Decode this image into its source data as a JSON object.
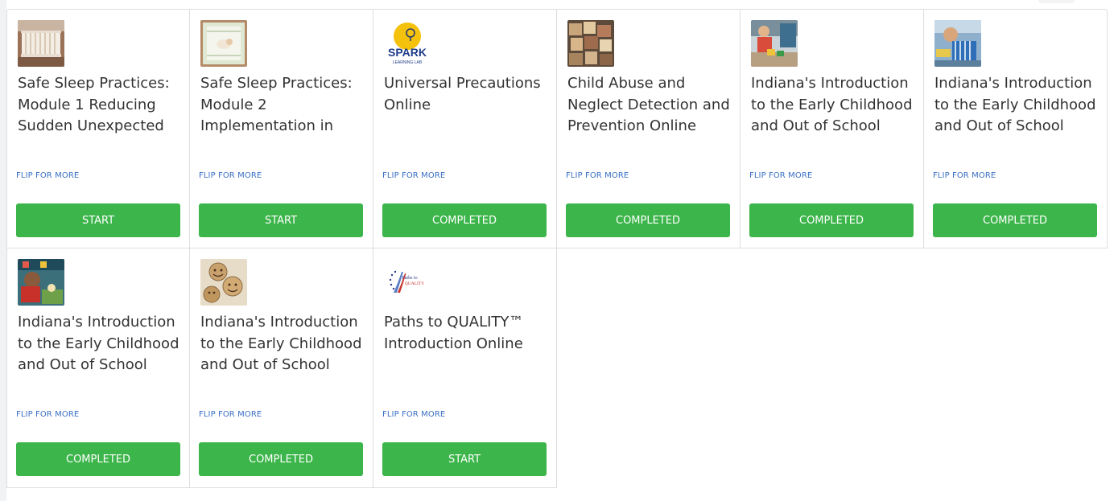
{
  "courses": [
    {
      "title": "Safe Sleep Practices: Module 1 Reducing Sudden Unexpected",
      "flip_label": "FLIP FOR MORE",
      "action_label": "START",
      "thumbnail": "crib-photo"
    },
    {
      "title": "Safe Sleep Practices: Module 2 Implementation in",
      "flip_label": "FLIP FOR MORE",
      "action_label": "START",
      "thumbnail": "sleeping-infant-photo"
    },
    {
      "title": "Universal Precautions Online",
      "flip_label": "FLIP FOR MORE",
      "action_label": "COMPLETED",
      "thumbnail": "spark-learning-lab-logo",
      "logo_text": "SPARK",
      "logo_subtext": "LEARNING LAB"
    },
    {
      "title": "Child Abuse and Neglect Detection and Prevention Online",
      "flip_label": "FLIP FOR MORE",
      "action_label": "COMPLETED",
      "thumbnail": "alphabet-blocks-photo"
    },
    {
      "title": "Indiana's Introduction to the Early Childhood and Out of School",
      "flip_label": "FLIP FOR MORE",
      "action_label": "COMPLETED",
      "thumbnail": "classroom-photo"
    },
    {
      "title": "Indiana's Introduction to the Early Childhood and Out of School",
      "flip_label": "FLIP FOR MORE",
      "action_label": "COMPLETED",
      "thumbnail": "child-playing-photo"
    },
    {
      "title": "Indiana's Introduction to the Early Childhood and Out of School",
      "flip_label": "FLIP FOR MORE",
      "action_label": "COMPLETED",
      "thumbnail": "child-crafts-photo"
    },
    {
      "title": "Indiana's Introduction to the Early Childhood and Out of School",
      "flip_label": "FLIP FOR MORE",
      "action_label": "COMPLETED",
      "thumbnail": "smiley-cookies-photo"
    },
    {
      "title": "Paths to QUALITY™ Introduction Online",
      "flip_label": "FLIP FOR MORE",
      "action_label": "START",
      "thumbnail": "paths-to-quality-logo",
      "logo_text": "Paths to",
      "logo_subtext": "QUALITY"
    }
  ],
  "colors": {
    "button_green": "#3cb54a",
    "flip_link_blue": "#3a6fc4",
    "title_text": "#333333",
    "card_border": "#dedede"
  }
}
